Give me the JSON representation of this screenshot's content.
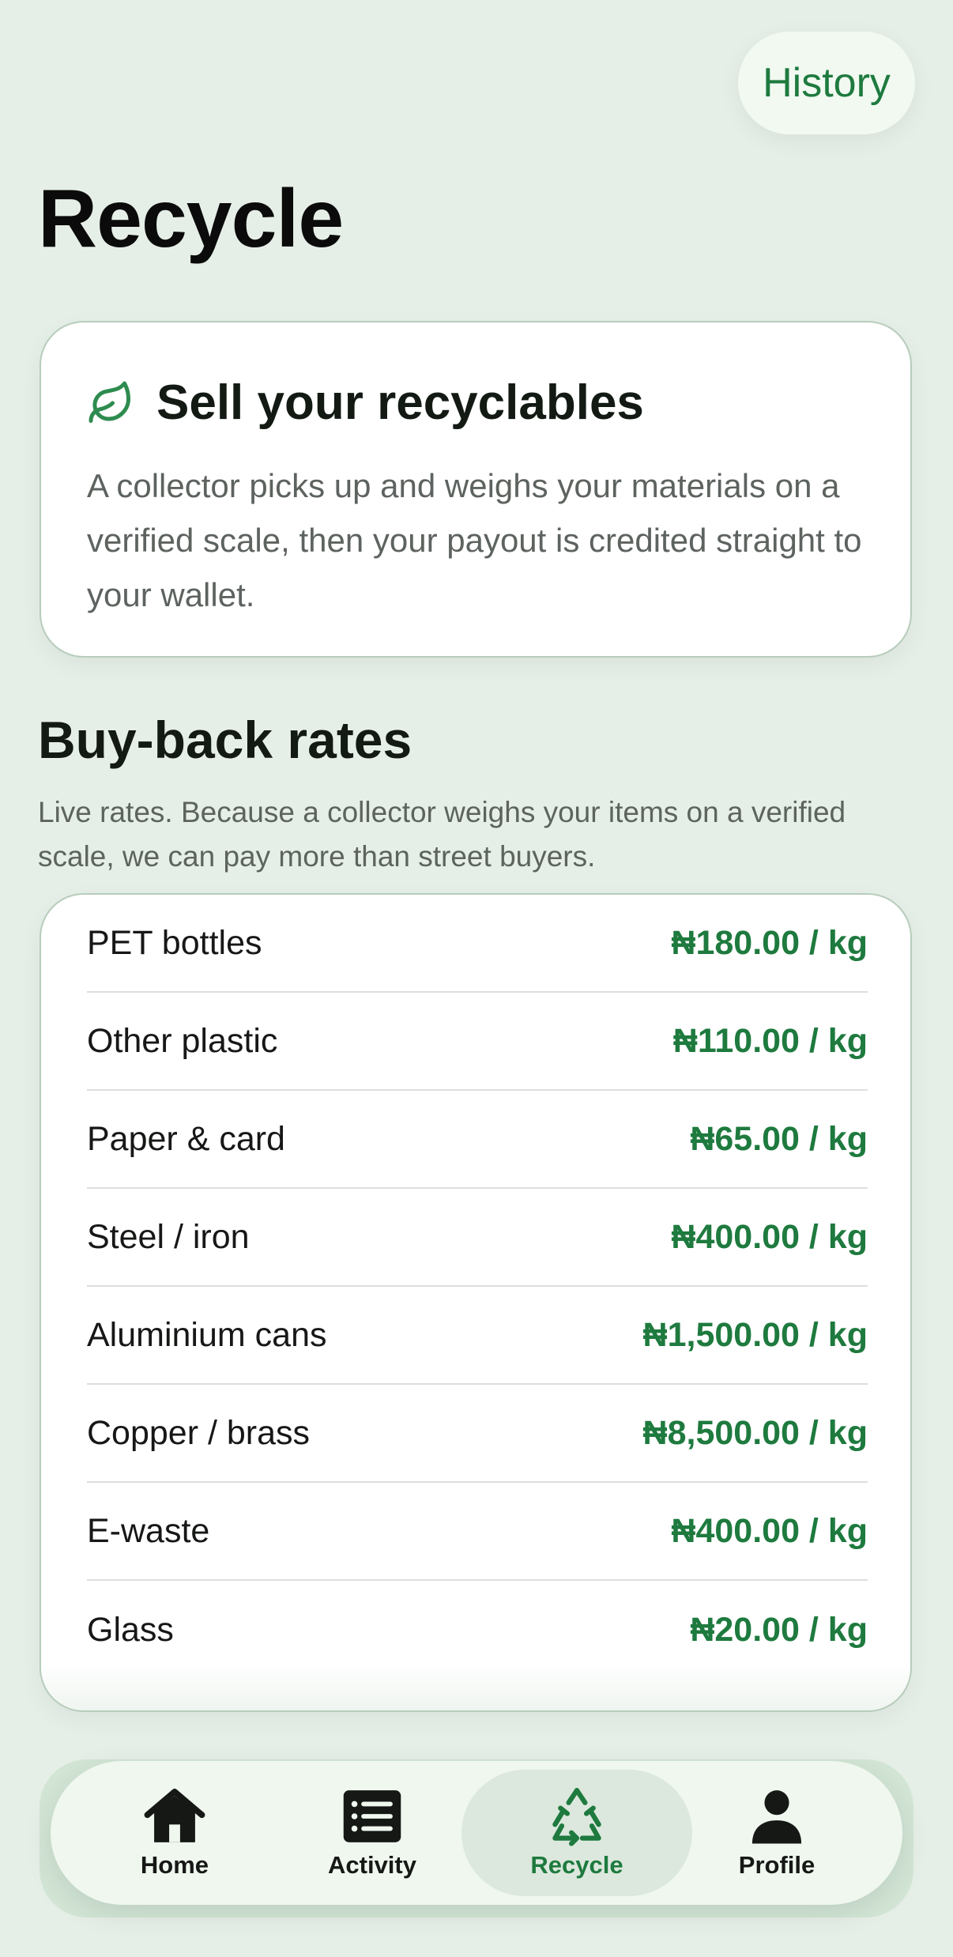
{
  "header": {
    "history_label": "History",
    "title": "Recycle"
  },
  "intro": {
    "title": "Sell your recyclables",
    "body": "A collector picks up and weighs your materials on a verified scale, then your payout is credited straight to your wallet."
  },
  "rates": {
    "title": "Buy-back rates",
    "subtitle": "Live rates. Because a collector weighs your items on a verified scale, we can pay more than street buyers.",
    "items": [
      {
        "name": "PET bottles",
        "price": "₦180.00 / kg"
      },
      {
        "name": "Other plastic",
        "price": "₦110.00 / kg"
      },
      {
        "name": "Paper & card",
        "price": "₦65.00 / kg"
      },
      {
        "name": "Steel / iron",
        "price": "₦400.00 / kg"
      },
      {
        "name": "Aluminium cans",
        "price": "₦1,500.00 / kg"
      },
      {
        "name": "Copper / brass",
        "price": "₦8,500.00 / kg"
      },
      {
        "name": "E-waste",
        "price": "₦400.00 / kg"
      },
      {
        "name": "Glass",
        "price": "₦20.00 / kg"
      }
    ]
  },
  "nav": {
    "items": [
      {
        "label": "Home",
        "icon": "home-icon"
      },
      {
        "label": "Activity",
        "icon": "list-icon"
      },
      {
        "label": "Recycle",
        "icon": "recycle-icon",
        "active": true
      },
      {
        "label": "Profile",
        "icon": "person-icon"
      }
    ]
  },
  "colors": {
    "accent": "#1e7a3e",
    "background": "#e6efe7",
    "card": "#ffffff"
  }
}
